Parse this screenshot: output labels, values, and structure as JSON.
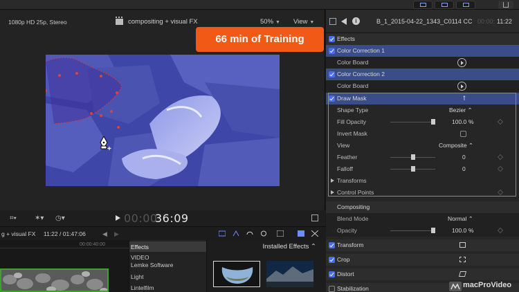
{
  "viewer": {
    "format": "1080p HD 25p, Stereo",
    "project_title": "compositing + visual FX",
    "zoom": "50%",
    "view_menu": "View",
    "timecode_dim": "00:00:",
    "timecode": "36:09"
  },
  "promo": {
    "text": "66 min of Training"
  },
  "inspector": {
    "clip_name": "B_1_2015-04-22_1343_C0114 CC",
    "clip_tc_dim": "00:00:",
    "clip_tc": "11:22",
    "effects_label": "Effects",
    "rows": {
      "cc1": "Color Correction 1",
      "cb1": "Color Board",
      "cc2": "Color Correction 2",
      "cb2": "Color Board",
      "draw_mask": "Draw Mask",
      "shape_type": "Shape Type",
      "shape_type_val": "Bezier",
      "fill_opacity": "Fill Opacity",
      "fill_opacity_val": "100.0",
      "invert_mask": "Invert Mask",
      "view": "View",
      "view_val": "Composite",
      "feather": "Feather",
      "feather_val": "0",
      "falloff": "Falloff",
      "falloff_val": "0",
      "transforms": "Transforms",
      "control_points": "Control Points",
      "compositing": "Compositing",
      "blend_mode": "Blend Mode",
      "blend_mode_val": "Normal",
      "opacity": "Opacity",
      "opacity_val": "100.0",
      "percent": "%",
      "transform": "Transform",
      "crop": "Crop",
      "distort": "Distort",
      "stabilization": "Stabilization"
    },
    "fill_opacity_level": 1.0,
    "feather_level": 0.5,
    "falloff_level": 0.5,
    "opacity_level": 1.0
  },
  "timeline": {
    "title": "g + visual FX",
    "time": "11:22 / 01:47:06",
    "ruler_tc": "00:00:40:00"
  },
  "effects_browser": {
    "header": "Effects",
    "items": [
      "VIDEO",
      "Lemke Software",
      "Light",
      "Lintelfilm"
    ],
    "installed": "Installed Effects"
  },
  "watermark": {
    "text": "macProVideo"
  },
  "colors": {
    "accent": "#4a6cf0",
    "promo": "#f05a16",
    "selected_row": "#3a4d8a"
  }
}
